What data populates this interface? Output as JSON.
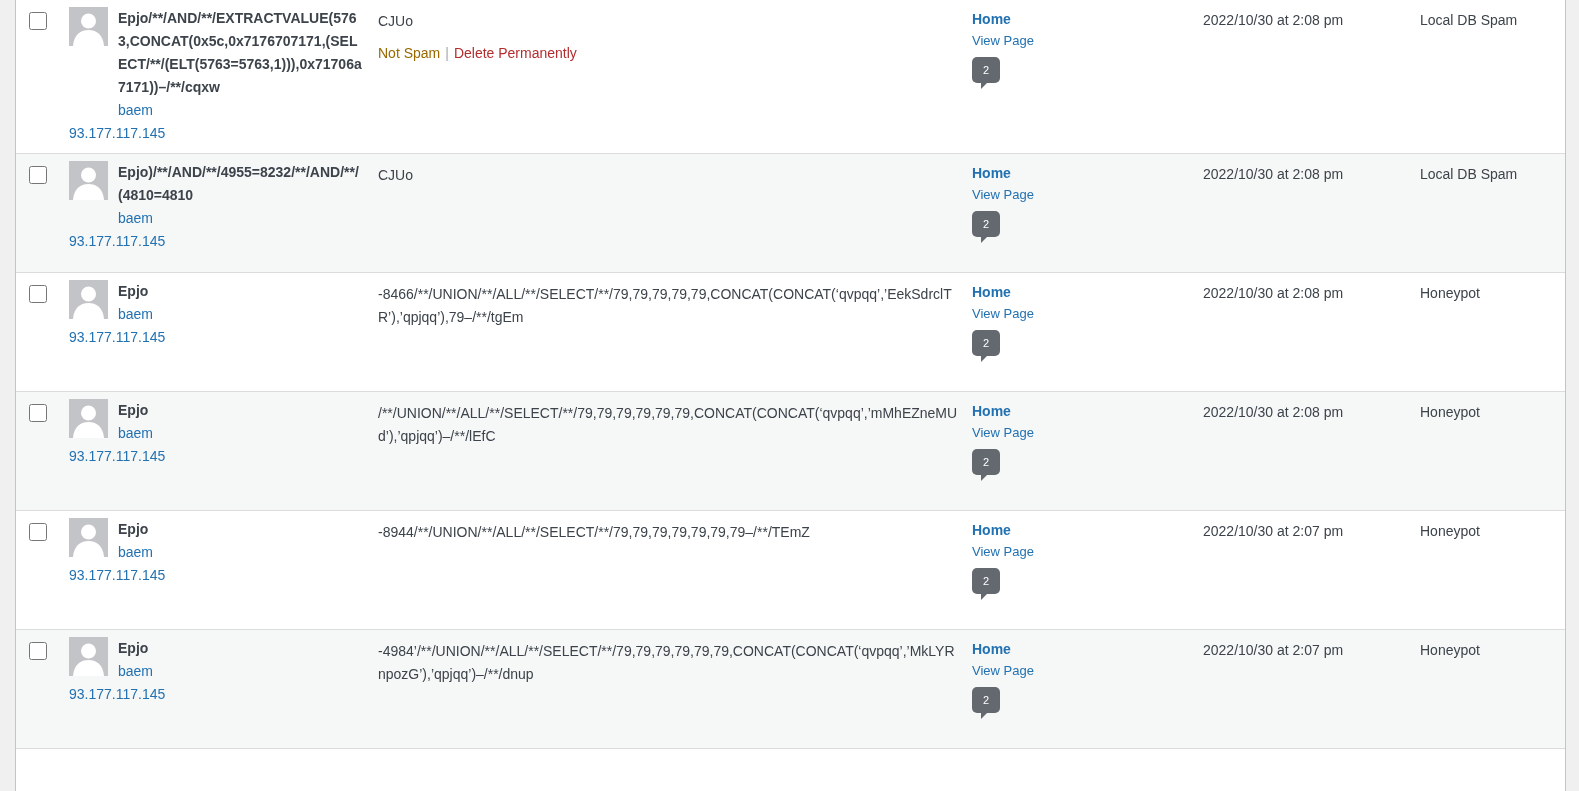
{
  "comments": [
    {
      "checked": false,
      "author": "Epjo/**/AND/**/EXTRACTVALUE(5763,CONCAT(0x5c,0x7176707171,(SELECT/**/(ELT(5763=5763,1))),0x71706a7171))–/**/cqxw",
      "author_link": "baem",
      "ip": "93.177.117.145",
      "comment": "CJUo",
      "actions": [
        {
          "label": "Not Spam",
          "kind": "unspam"
        },
        {
          "label": "Delete Permanently",
          "kind": "delete"
        }
      ],
      "action_separator": "|",
      "response_title": "Home",
      "response_link": "View Page",
      "response_count": "2",
      "date": "2022/10/30 at 2:08 pm",
      "type": "Local DB Spam"
    },
    {
      "checked": false,
      "author": "Epjo)/**/AND/**/4955=8232/**/AND/**/(4810=4810",
      "author_link": "baem",
      "ip": "93.177.117.145",
      "comment": "CJUo",
      "response_title": "Home",
      "response_link": "View Page",
      "response_count": "2",
      "date": "2022/10/30 at 2:08 pm",
      "type": "Local DB Spam"
    },
    {
      "checked": false,
      "author": "Epjo",
      "author_link": "baem",
      "ip": "93.177.117.145",
      "comment": "-8466/**/UNION/**/ALL/**/SELECT/**/79,79,79,79,79,CONCAT(CONCAT(‘qvpqq’,’EekSdrclTR’),’qpjqq’),79–/**/tgEm",
      "response_title": "Home",
      "response_link": "View Page",
      "response_count": "2",
      "date": "2022/10/30 at 2:08 pm",
      "type": "Honeypot"
    },
    {
      "checked": false,
      "author": "Epjo",
      "author_link": "baem",
      "ip": "93.177.117.145",
      "comment": "/**/UNION/**/ALL/**/SELECT/**/79,79,79,79,79,79,CONCAT(CONCAT(‘qvpqq’,’mMhEZneMUd’),’qpjqq’)–/**/lEfC",
      "response_title": "Home",
      "response_link": "View Page",
      "response_count": "2",
      "date": "2022/10/30 at 2:08 pm",
      "type": "Honeypot"
    },
    {
      "checked": false,
      "author": "Epjo",
      "author_link": "baem",
      "ip": "93.177.117.145",
      "comment": "-8944/**/UNION/**/ALL/**/SELECT/**/79,79,79,79,79,79,79–/**/TEmZ",
      "response_title": "Home",
      "response_link": "View Page",
      "response_count": "2",
      "date": "2022/10/30 at 2:07 pm",
      "type": "Honeypot"
    },
    {
      "checked": false,
      "author": "Epjo",
      "author_link": "baem",
      "ip": "93.177.117.145",
      "comment": "-4984’/**/UNION/**/ALL/**/SELECT/**/79,79,79,79,79,79,CONCAT(CONCAT(‘qvpqq’,’MkLYRnpozG’),’qpjqq’)–/**/dnup",
      "response_title": "Home",
      "response_link": "View Page",
      "response_count": "2",
      "date": "2022/10/30 at 2:07 pm",
      "type": "Honeypot"
    }
  ]
}
